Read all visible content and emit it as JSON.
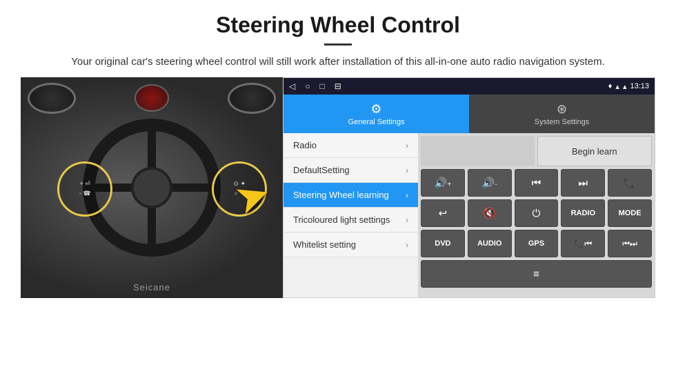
{
  "header": {
    "title": "Steering Wheel Control",
    "subtitle": "Your original car's steering wheel control will still work after installation of this all-in-one auto radio navigation system."
  },
  "statusbar": {
    "nav_back": "◁",
    "nav_home": "○",
    "nav_square": "□",
    "nav_menu": "⊟",
    "time": "13:13",
    "signal": "▾▴"
  },
  "tabs": {
    "general": {
      "label": "General Settings",
      "icon": "⚙"
    },
    "system": {
      "label": "System Settings",
      "icon": "⊛"
    }
  },
  "menu_items": [
    {
      "label": "Radio",
      "active": false
    },
    {
      "label": "DefaultSetting",
      "active": false
    },
    {
      "label": "Steering Wheel learning",
      "active": true
    },
    {
      "label": "Tricoloured light settings",
      "active": false
    },
    {
      "label": "Whitelist setting",
      "active": false
    }
  ],
  "panel": {
    "begin_learn": "Begin learn",
    "buttons_row1": [
      "🔊+",
      "🔊-",
      "⏮",
      "⏭",
      "📞"
    ],
    "buttons_row2": [
      "↩",
      "🔇",
      "⏻",
      "RADIO",
      "MODE"
    ],
    "buttons_row3": [
      "DVD",
      "AUDIO",
      "GPS",
      "📞⏮",
      "⏮⏭"
    ],
    "buttons_row4": [
      "≡"
    ]
  },
  "watermark": "Seicane"
}
